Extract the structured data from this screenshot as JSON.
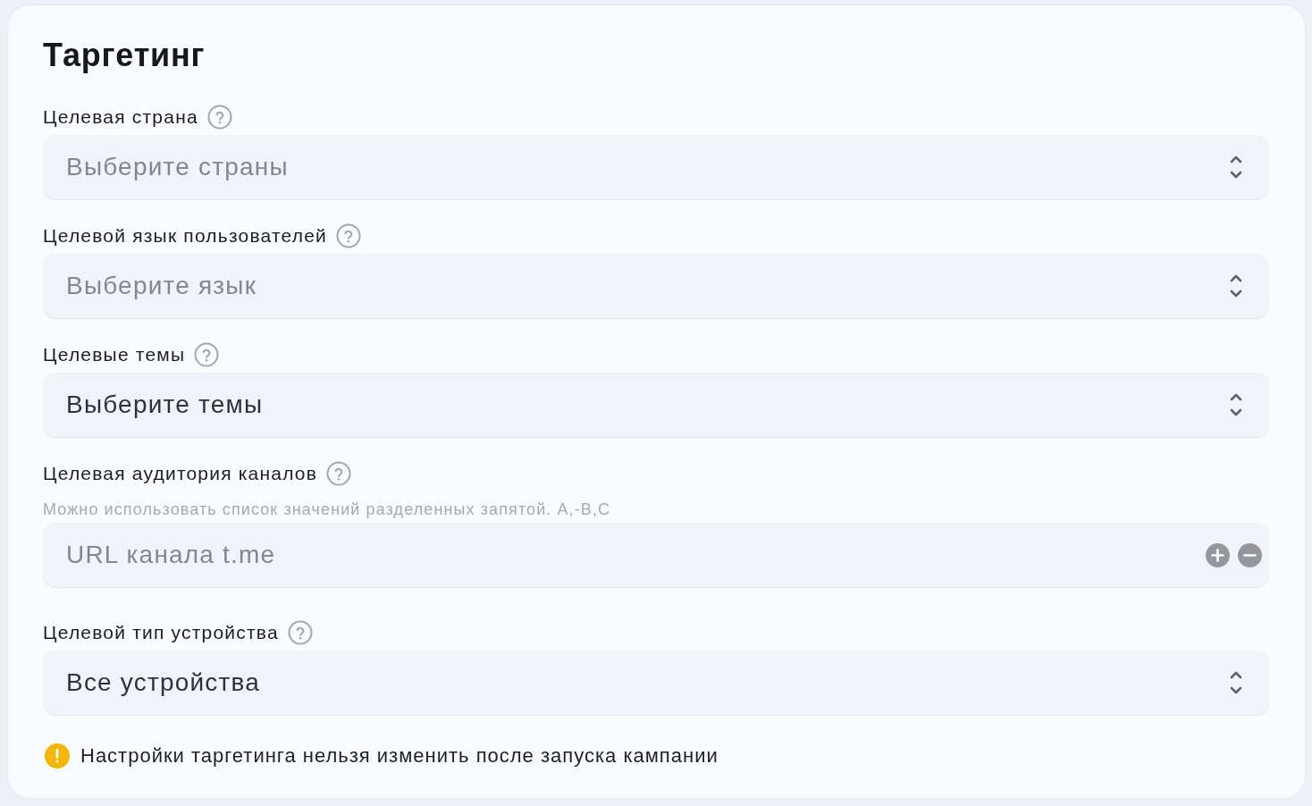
{
  "title": "Таргетинг",
  "fields": [
    {
      "kind": "select",
      "label": "Целевая страна",
      "placeholder": "Выберите страны"
    },
    {
      "kind": "select",
      "label": "Целевой язык пользователей",
      "placeholder": "Выберите язык"
    },
    {
      "kind": "select",
      "label": "Целевые темы",
      "value": "Выберите темы"
    },
    {
      "kind": "list",
      "label": "Целевая аудитория каналов",
      "hint": "Можно использовать список значений разделенных запятой. A,-B,C",
      "placeholder": "URL канала t.me"
    },
    {
      "kind": "select",
      "label": "Целевой тип устройства",
      "value": "Все устройства"
    }
  ],
  "notice": {
    "text": "Настройки таргетинга нельзя изменить после запуска кампании"
  }
}
